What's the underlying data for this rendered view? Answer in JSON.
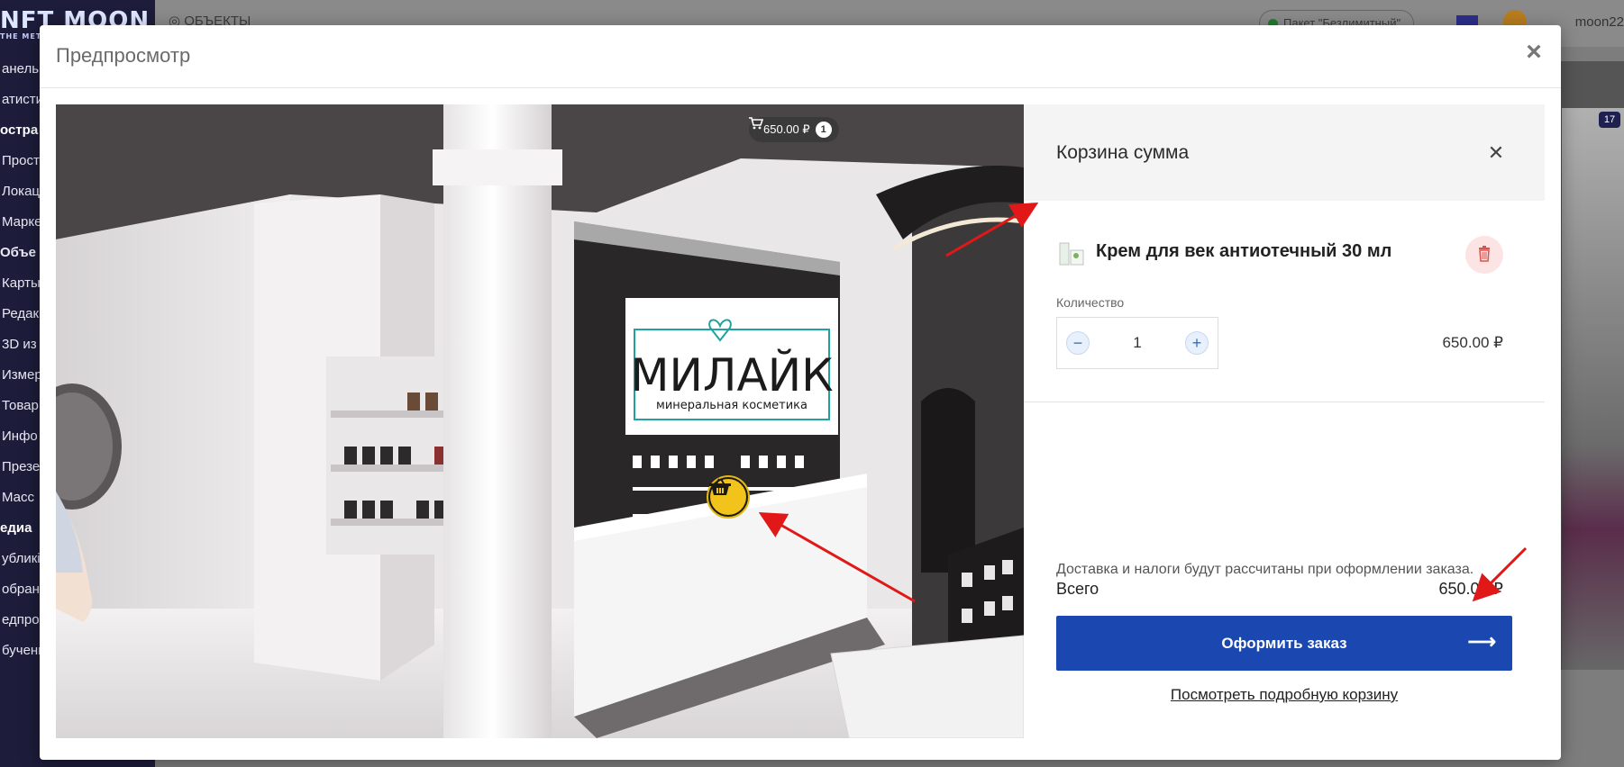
{
  "background": {
    "logo": "NFT MOON",
    "logo_sub": "THE METAVERSE",
    "breadcrumb": "ОБЪЕКТЫ",
    "package_badge": "Пакет \"Безлимитный\"",
    "username": "moon22",
    "card_badge": "17",
    "sidebar": {
      "items": [
        {
          "label": "анель у",
          "kind": "sub"
        },
        {
          "label": "атистик",
          "kind": "sub"
        },
        {
          "label": "остра",
          "kind": "section"
        },
        {
          "label": "Прост",
          "kind": "sub"
        },
        {
          "label": "Локац",
          "kind": "sub"
        },
        {
          "label": "Марке",
          "kind": "sub"
        },
        {
          "label": "Объе",
          "kind": "active"
        },
        {
          "label": "Карты",
          "kind": "sub"
        },
        {
          "label": "Редак",
          "kind": "sub"
        },
        {
          "label": "3D из",
          "kind": "sub"
        },
        {
          "label": "Измер",
          "kind": "sub"
        },
        {
          "label": "Товар",
          "kind": "sub"
        },
        {
          "label": "Инфо",
          "kind": "sub"
        },
        {
          "label": "Презе",
          "kind": "sub"
        },
        {
          "label": "Масс",
          "kind": "sub"
        },
        {
          "label": "едиа",
          "kind": "section"
        },
        {
          "label": "убликі",
          "kind": "sub"
        },
        {
          "label": "обранн",
          "kind": "sub"
        },
        {
          "label": "едпро",
          "kind": "sub"
        },
        {
          "label": "бучени",
          "kind": "sub"
        }
      ]
    }
  },
  "modal": {
    "title": "Предпросмотр",
    "close_icon": "close-icon"
  },
  "tour": {
    "cart_pill": {
      "amount": "650.00 ₽",
      "count": "1",
      "icon": "cart-icon"
    },
    "store_sign": {
      "brand": "МИЛАЙК",
      "tagline": "минеральная косметика"
    },
    "hotspot_icon": "basket-icon"
  },
  "cart": {
    "title": "Корзина сумма",
    "item": {
      "name": "Крем для век антиотечный 30 мл",
      "quantity_label": "Количество",
      "quantity": "1",
      "price": "650.00 ₽"
    },
    "note": "Доставка и налоги будут рассчитаны при оформлении заказа.",
    "total_label": "Всего",
    "total_value": "650.00 ₽",
    "checkout_label": "Оформить заказ",
    "view_cart_label": "Посмотреть подробную корзину"
  },
  "colors": {
    "primary": "#1b47b0",
    "delete_bg": "#fde4e4",
    "delete_fg": "#d9534f",
    "annotation": "#e01818",
    "hotspot": "#f2c31a"
  }
}
